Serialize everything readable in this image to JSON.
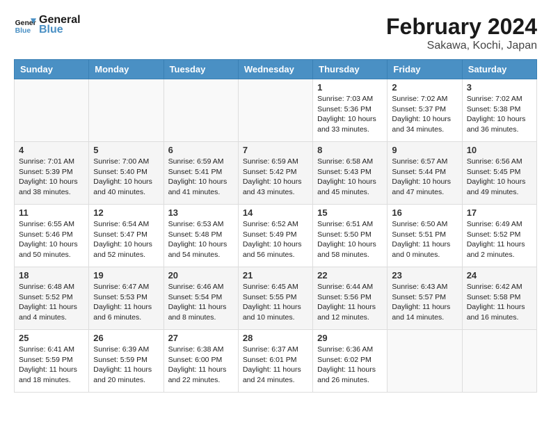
{
  "logo": {
    "line1": "General",
    "line2": "Blue"
  },
  "title": "February 2024",
  "location": "Sakawa, Kochi, Japan",
  "weekdays": [
    "Sunday",
    "Monday",
    "Tuesday",
    "Wednesday",
    "Thursday",
    "Friday",
    "Saturday"
  ],
  "weeks": [
    {
      "shaded": false,
      "days": [
        {
          "num": "",
          "info": ""
        },
        {
          "num": "",
          "info": ""
        },
        {
          "num": "",
          "info": ""
        },
        {
          "num": "",
          "info": ""
        },
        {
          "num": "1",
          "info": "Sunrise: 7:03 AM\nSunset: 5:36 PM\nDaylight: 10 hours\nand 33 minutes."
        },
        {
          "num": "2",
          "info": "Sunrise: 7:02 AM\nSunset: 5:37 PM\nDaylight: 10 hours\nand 34 minutes."
        },
        {
          "num": "3",
          "info": "Sunrise: 7:02 AM\nSunset: 5:38 PM\nDaylight: 10 hours\nand 36 minutes."
        }
      ]
    },
    {
      "shaded": true,
      "days": [
        {
          "num": "4",
          "info": "Sunrise: 7:01 AM\nSunset: 5:39 PM\nDaylight: 10 hours\nand 38 minutes."
        },
        {
          "num": "5",
          "info": "Sunrise: 7:00 AM\nSunset: 5:40 PM\nDaylight: 10 hours\nand 40 minutes."
        },
        {
          "num": "6",
          "info": "Sunrise: 6:59 AM\nSunset: 5:41 PM\nDaylight: 10 hours\nand 41 minutes."
        },
        {
          "num": "7",
          "info": "Sunrise: 6:59 AM\nSunset: 5:42 PM\nDaylight: 10 hours\nand 43 minutes."
        },
        {
          "num": "8",
          "info": "Sunrise: 6:58 AM\nSunset: 5:43 PM\nDaylight: 10 hours\nand 45 minutes."
        },
        {
          "num": "9",
          "info": "Sunrise: 6:57 AM\nSunset: 5:44 PM\nDaylight: 10 hours\nand 47 minutes."
        },
        {
          "num": "10",
          "info": "Sunrise: 6:56 AM\nSunset: 5:45 PM\nDaylight: 10 hours\nand 49 minutes."
        }
      ]
    },
    {
      "shaded": false,
      "days": [
        {
          "num": "11",
          "info": "Sunrise: 6:55 AM\nSunset: 5:46 PM\nDaylight: 10 hours\nand 50 minutes."
        },
        {
          "num": "12",
          "info": "Sunrise: 6:54 AM\nSunset: 5:47 PM\nDaylight: 10 hours\nand 52 minutes."
        },
        {
          "num": "13",
          "info": "Sunrise: 6:53 AM\nSunset: 5:48 PM\nDaylight: 10 hours\nand 54 minutes."
        },
        {
          "num": "14",
          "info": "Sunrise: 6:52 AM\nSunset: 5:49 PM\nDaylight: 10 hours\nand 56 minutes."
        },
        {
          "num": "15",
          "info": "Sunrise: 6:51 AM\nSunset: 5:50 PM\nDaylight: 10 hours\nand 58 minutes."
        },
        {
          "num": "16",
          "info": "Sunrise: 6:50 AM\nSunset: 5:51 PM\nDaylight: 11 hours\nand 0 minutes."
        },
        {
          "num": "17",
          "info": "Sunrise: 6:49 AM\nSunset: 5:52 PM\nDaylight: 11 hours\nand 2 minutes."
        }
      ]
    },
    {
      "shaded": true,
      "days": [
        {
          "num": "18",
          "info": "Sunrise: 6:48 AM\nSunset: 5:52 PM\nDaylight: 11 hours\nand 4 minutes."
        },
        {
          "num": "19",
          "info": "Sunrise: 6:47 AM\nSunset: 5:53 PM\nDaylight: 11 hours\nand 6 minutes."
        },
        {
          "num": "20",
          "info": "Sunrise: 6:46 AM\nSunset: 5:54 PM\nDaylight: 11 hours\nand 8 minutes."
        },
        {
          "num": "21",
          "info": "Sunrise: 6:45 AM\nSunset: 5:55 PM\nDaylight: 11 hours\nand 10 minutes."
        },
        {
          "num": "22",
          "info": "Sunrise: 6:44 AM\nSunset: 5:56 PM\nDaylight: 11 hours\nand 12 minutes."
        },
        {
          "num": "23",
          "info": "Sunrise: 6:43 AM\nSunset: 5:57 PM\nDaylight: 11 hours\nand 14 minutes."
        },
        {
          "num": "24",
          "info": "Sunrise: 6:42 AM\nSunset: 5:58 PM\nDaylight: 11 hours\nand 16 minutes."
        }
      ]
    },
    {
      "shaded": false,
      "days": [
        {
          "num": "25",
          "info": "Sunrise: 6:41 AM\nSunset: 5:59 PM\nDaylight: 11 hours\nand 18 minutes."
        },
        {
          "num": "26",
          "info": "Sunrise: 6:39 AM\nSunset: 5:59 PM\nDaylight: 11 hours\nand 20 minutes."
        },
        {
          "num": "27",
          "info": "Sunrise: 6:38 AM\nSunset: 6:00 PM\nDaylight: 11 hours\nand 22 minutes."
        },
        {
          "num": "28",
          "info": "Sunrise: 6:37 AM\nSunset: 6:01 PM\nDaylight: 11 hours\nand 24 minutes."
        },
        {
          "num": "29",
          "info": "Sunrise: 6:36 AM\nSunset: 6:02 PM\nDaylight: 11 hours\nand 26 minutes."
        },
        {
          "num": "",
          "info": ""
        },
        {
          "num": "",
          "info": ""
        }
      ]
    }
  ]
}
